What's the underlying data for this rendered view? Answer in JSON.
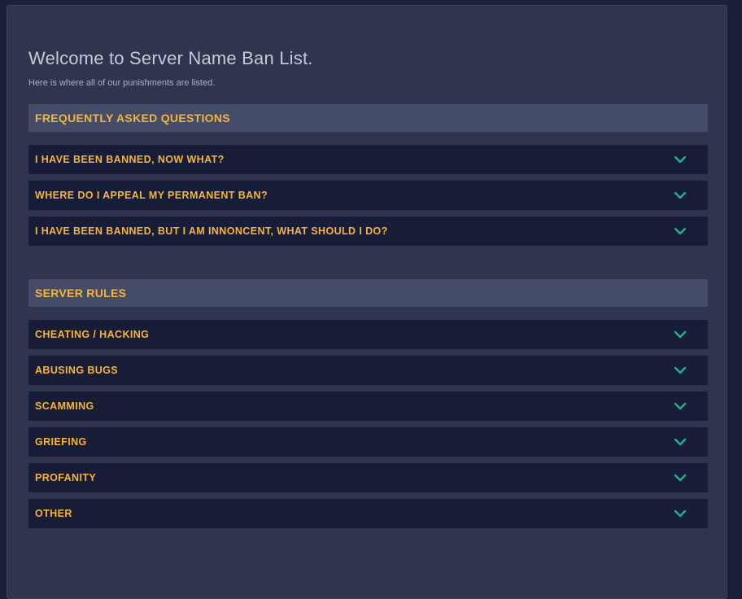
{
  "page": {
    "title": "Welcome to Server Name Ban List.",
    "subtitle": "Here is where all of our punishments are listed."
  },
  "faq": {
    "header": "FREQUENTLY ASKED QUESTIONS",
    "items": [
      {
        "label": "I HAVE BEEN BANNED, NOW WHAT?",
        "icon": "chevron-down-icon"
      },
      {
        "label": "WHERE DO I APPEAL MY PERMANENT BAN?",
        "icon": "chevron-down-icon"
      },
      {
        "label": "I HAVE BEEN BANNED, BUT I AM INNONCENT, WHAT SHOULD I DO?",
        "icon": "chevron-down-icon"
      }
    ]
  },
  "rules": {
    "header": "SERVER RULES",
    "items": [
      {
        "label": "CHEATING / HACKING",
        "icon": "chevron-down-icon"
      },
      {
        "label": "ABUSING BUGS",
        "icon": "chevron-down-icon"
      },
      {
        "label": "SCAMMING",
        "icon": "chevron-down-icon"
      },
      {
        "label": "GRIEFING",
        "icon": "chevron-down-icon"
      },
      {
        "label": "PROFANITY",
        "icon": "chevron-down-icon"
      },
      {
        "label": "OTHER",
        "icon": "chevron-down-icon"
      }
    ]
  },
  "colors": {
    "background": "#1b1f38",
    "panel": "#30354f",
    "section_header": "#454c68",
    "item": "#171c37",
    "accent_text": "#f6b43c",
    "chevron": "#1fb489"
  }
}
